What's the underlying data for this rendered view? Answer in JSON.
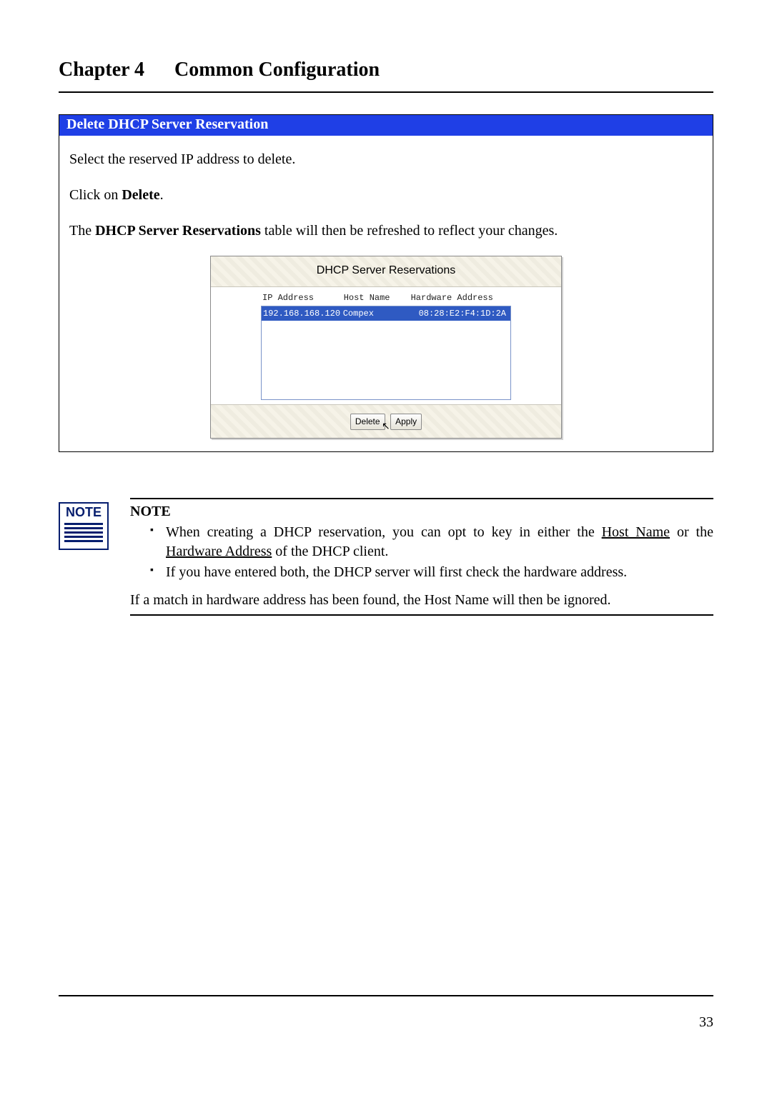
{
  "chapter": {
    "heading": "Chapter 4   Common Configuration"
  },
  "section": {
    "header": "Delete DHCP Server Reservation",
    "p1": "Select the reserved IP address to delete.",
    "p2_pre": "Click on ",
    "p2_strong": "Delete",
    "p2_post": ".",
    "p3_pre": "The ",
    "p3_strong": "DHCP Server Reservations",
    "p3_post": " table will then be refreshed to reflect your changes."
  },
  "shot": {
    "title": "DHCP Server Reservations",
    "cols": {
      "ip": "IP Address",
      "host": "Host Name",
      "hw": "Hardware Address"
    },
    "row": {
      "ip": "192.168.168.120",
      "host": "Compex",
      "hw": "08:28:E2:F4:1D:2A"
    },
    "buttons": {
      "delete": "Delete",
      "apply": "Apply"
    }
  },
  "note": {
    "icon_label": "NOTE",
    "heading": "NOTE",
    "item1_pre": "When creating a DHCP reservation, you can opt to key in either the ",
    "item1_u1": "Host Name",
    "item1_mid": " or the ",
    "item1_u2": "Hardware Address",
    "item1_post": " of the DHCP client.",
    "item2": "If you have entered both, the DHCP server will first check the hardware address.",
    "para": "If a match in hardware address has been found, the Host Name will then be ignored."
  },
  "page_number": "33"
}
